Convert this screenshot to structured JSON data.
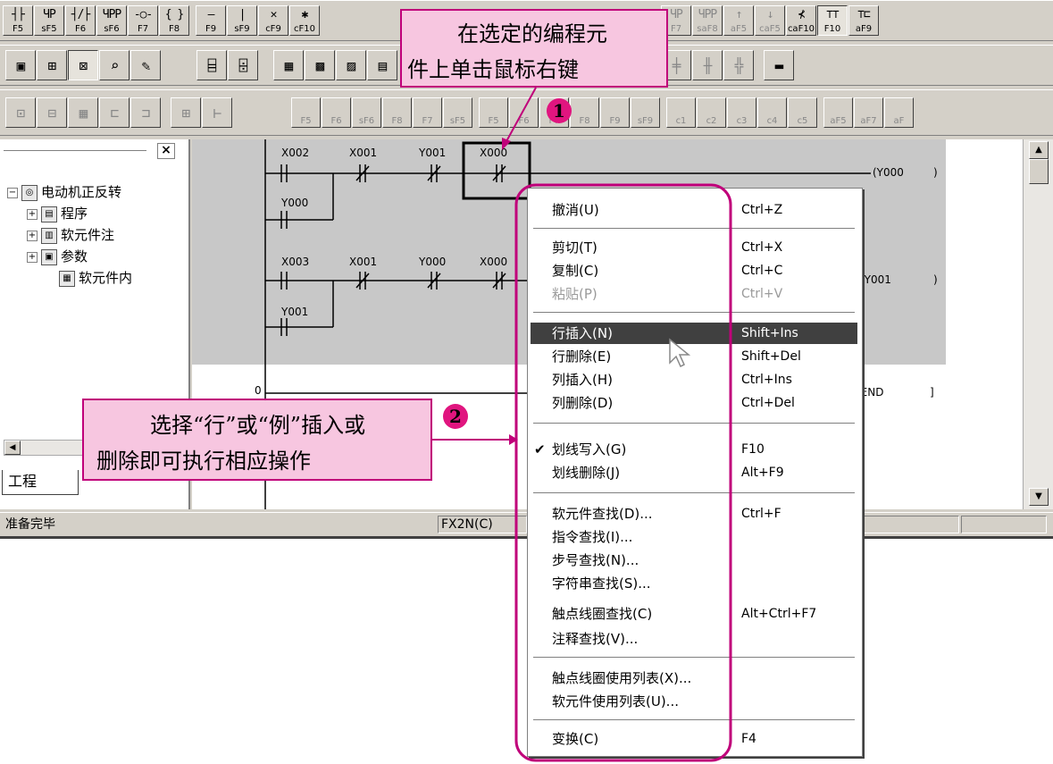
{
  "toolbar1": {
    "buttons": [
      {
        "glyph": "┤├",
        "key": "F5"
      },
      {
        "glyph": "ЧР",
        "key": "sF5"
      },
      {
        "glyph": "┤/├",
        "key": "F6"
      },
      {
        "glyph": "ЧРР",
        "key": "sF6"
      },
      {
        "glyph": "-○-",
        "key": "F7"
      },
      {
        "glyph": "{ }",
        "key": "F8"
      },
      {
        "glyph": "—",
        "key": "F9"
      },
      {
        "glyph": "|",
        "key": "sF9"
      },
      {
        "glyph": "✕",
        "key": "cF9"
      },
      {
        "glyph": "✱",
        "key": "cF10"
      }
    ],
    "buttons_right": [
      {
        "glyph": "ЧР",
        "key": "F7"
      },
      {
        "glyph": "ЧРР",
        "key": "saF8"
      },
      {
        "glyph": "↑",
        "key": "aF5"
      },
      {
        "glyph": "↓",
        "key": "caF5"
      },
      {
        "glyph": "⊀",
        "key": "caF10"
      },
      {
        "glyph": "⊤⊤",
        "key": "F10"
      },
      {
        "glyph": "⊤⊏",
        "key": "aF9"
      }
    ]
  },
  "toolbar3": {
    "keys": [
      "F5",
      "F6",
      "sF6",
      "F8",
      "F7",
      "sF5",
      "F5",
      "F6",
      "F7",
      "F8",
      "F9",
      "sF9",
      "c1",
      "c2",
      "c3",
      "c4",
      "c5",
      "aF5",
      "aF7",
      "aF"
    ]
  },
  "tree": {
    "close_glyph": "×",
    "root": "电动机正反转",
    "items": [
      "程序",
      "软元件注",
      "参数",
      "软元件内"
    ],
    "tab": "工程"
  },
  "ladder": {
    "rung1": {
      "contacts": [
        "X002",
        "X001",
        "Y001",
        "X000"
      ],
      "branch": "Y000",
      "coil": "(Y000",
      "coil_end": ")"
    },
    "rung2": {
      "contacts": [
        "X003",
        "X001",
        "Y000",
        "X000"
      ],
      "branch": "Y001",
      "coil": "(Y001",
      "coil_end": ")"
    },
    "rung3": {
      "step": "0",
      "end": "[END",
      "end_close": "]"
    }
  },
  "status": {
    "ready": "准备完毕",
    "plc": "FX2N(C)"
  },
  "menu": {
    "items": [
      {
        "label": "撤消(U)",
        "shortcut": "Ctrl+Z",
        "disabled": false
      },
      {
        "label": "剪切(T)",
        "shortcut": "Ctrl+X",
        "disabled": false
      },
      {
        "label": "复制(C)",
        "shortcut": "Ctrl+C",
        "disabled": false
      },
      {
        "label": "粘贴(P)",
        "shortcut": "Ctrl+V",
        "disabled": true
      },
      {
        "label": "行插入(N)",
        "shortcut": "Shift+Ins",
        "highlighted": true
      },
      {
        "label": "行删除(E)",
        "shortcut": "Shift+Del"
      },
      {
        "label": "列插入(H)",
        "shortcut": "Ctrl+Ins"
      },
      {
        "label": "列删除(D)",
        "shortcut": "Ctrl+Del"
      },
      {
        "label": "划线写入(G)",
        "shortcut": "F10",
        "checked": true
      },
      {
        "label": "划线删除(J)",
        "shortcut": "Alt+F9"
      },
      {
        "label": "软元件查找(D)...",
        "shortcut": "Ctrl+F"
      },
      {
        "label": "指令查找(I)...",
        "shortcut": ""
      },
      {
        "label": "步号查找(N)...",
        "shortcut": ""
      },
      {
        "label": "字符串查找(S)...",
        "shortcut": ""
      },
      {
        "label": "触点线圈查找(C)",
        "shortcut": "Alt+Ctrl+F7"
      },
      {
        "label": "注释查找(V)...",
        "shortcut": ""
      },
      {
        "label": "触点线圈使用列表(X)...",
        "shortcut": ""
      },
      {
        "label": "软元件使用列表(U)...",
        "shortcut": ""
      },
      {
        "label": "变换(C)",
        "shortcut": "F4"
      }
    ],
    "check_glyph": "✔"
  },
  "callouts": {
    "top": {
      "line1": "在选定的编程元",
      "line2": "件上单击鼠标右键",
      "badge": "1"
    },
    "left": {
      "line1": "选择“行”或“例”插入或",
      "line2": "删除即可执行相应操作",
      "badge": "2"
    }
  },
  "colors": {
    "callout_fill": "#f7c6e0",
    "callout_border": "#c0007a",
    "badge": "#e0157f",
    "highlight": "#404040",
    "ladder_gray": "#c8c8c8"
  }
}
